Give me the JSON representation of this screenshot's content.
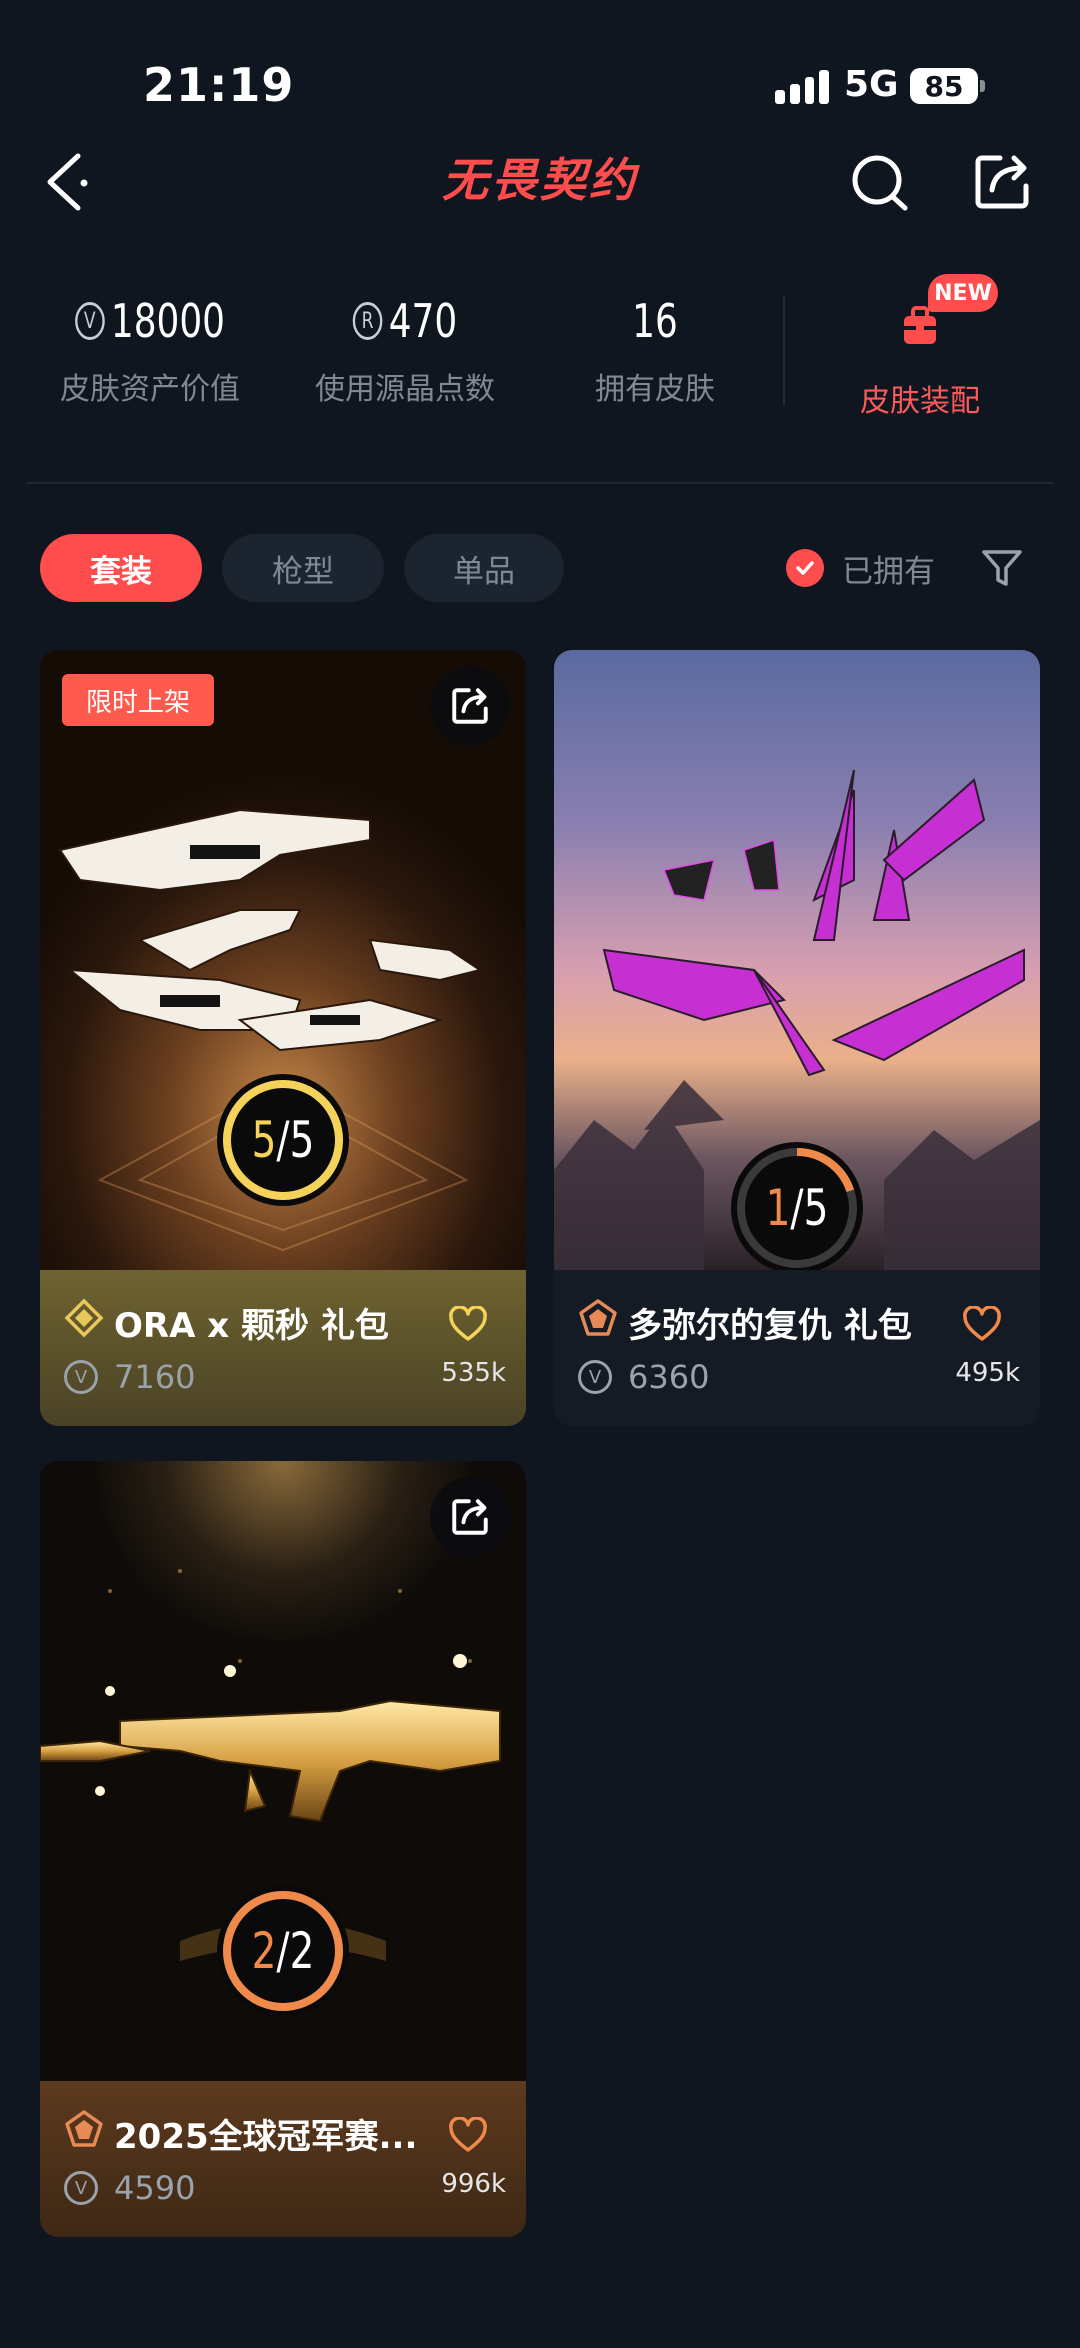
{
  "status_bar": {
    "time": "21:19",
    "network": "5G",
    "battery": "85"
  },
  "header": {
    "logo_text": "无畏契约"
  },
  "stats": [
    {
      "value": "18000",
      "label": "皮肤资产价值",
      "icon": "vp-coin-icon"
    },
    {
      "value": "470",
      "label": "使用源晶点数",
      "icon": "radianite-icon"
    },
    {
      "value": "16",
      "label": "拥有皮肤"
    }
  ],
  "outfit": {
    "label": "皮肤装配",
    "badge": "NEW",
    "icon": "backpack-icon"
  },
  "tabs": [
    {
      "label": "套装",
      "active": true
    },
    {
      "label": "枪型",
      "active": false
    },
    {
      "label": "单品",
      "active": false
    }
  ],
  "owned_filter": {
    "label": "已拥有",
    "checked": true
  },
  "cards": [
    {
      "title": "ORA x 颗秒 礼包",
      "price": "7160",
      "likes": "535k",
      "owned": "5",
      "total": "5",
      "progress": 1.0,
      "badge": "限时上架",
      "rank_color": "#e8c85a",
      "accent": "#f5d35a"
    },
    {
      "title": "多弥尔的复仇 礼包",
      "price": "6360",
      "likes": "495k",
      "owned": "1",
      "total": "5",
      "progress": 0.2,
      "rank_color": "#e88a55",
      "accent": "#f08a4b"
    },
    {
      "title": "2025全球冠军赛...",
      "price": "4590",
      "likes": "996k",
      "owned": "2",
      "total": "2",
      "progress": 1.0,
      "rank_color": "#e88a55",
      "accent": "#f08a4b"
    }
  ]
}
